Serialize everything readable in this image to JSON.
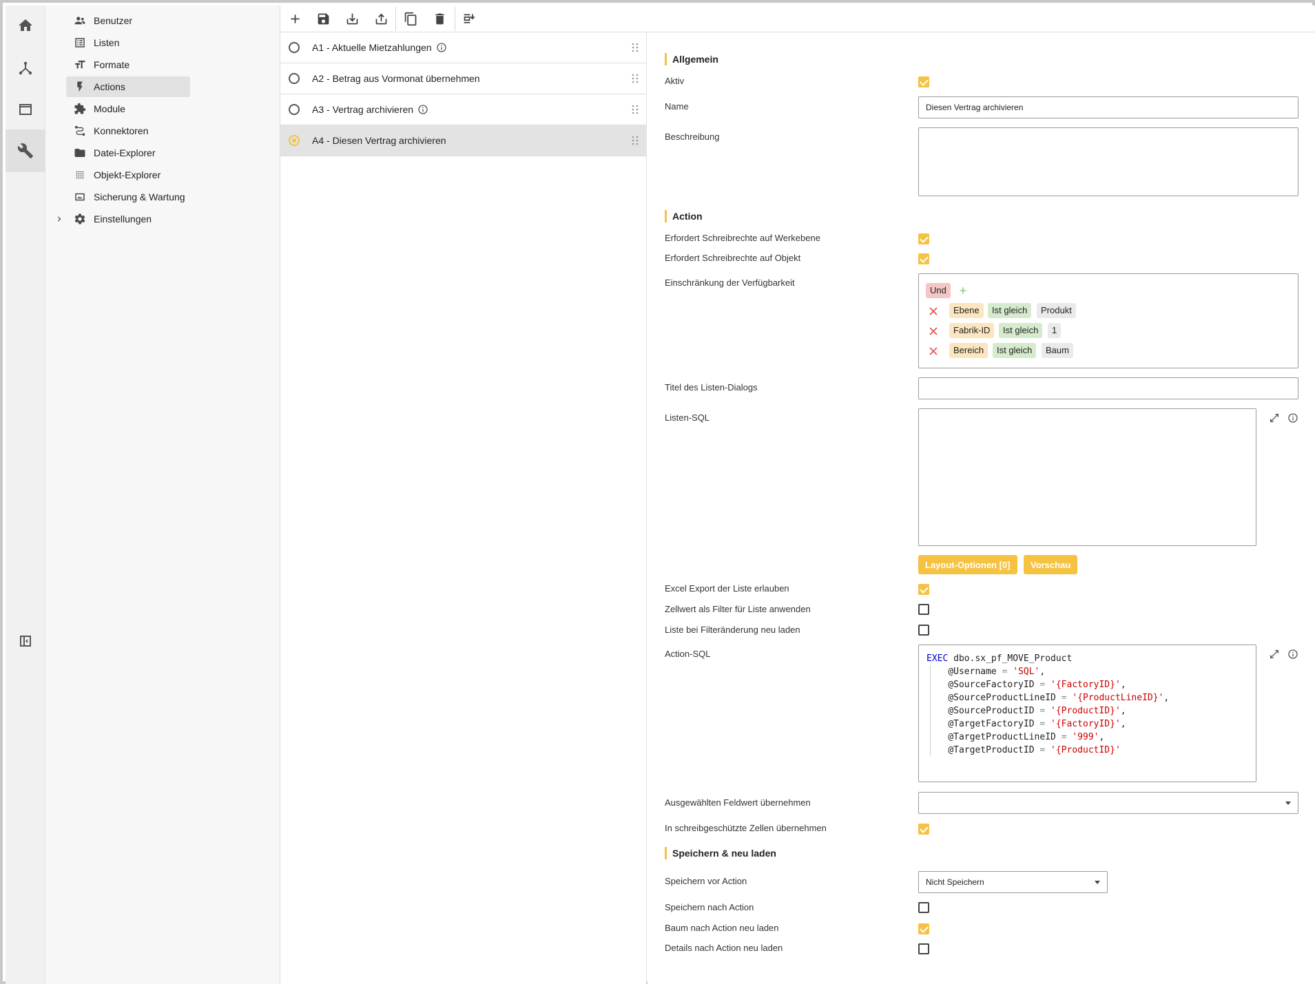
{
  "rail": {
    "items": [
      {
        "icon": "home-icon"
      },
      {
        "icon": "hierarchy-icon"
      },
      {
        "icon": "layout-icon"
      },
      {
        "icon": "wrench-icon",
        "active": true
      }
    ],
    "bottom_icon": "panel-toggle-icon"
  },
  "nav": {
    "items": [
      {
        "label": "Benutzer",
        "icon": "users-icon"
      },
      {
        "label": "Listen",
        "icon": "list-icon"
      },
      {
        "label": "Formate",
        "icon": "text-format-icon"
      },
      {
        "label": "Actions",
        "icon": "lightning-icon",
        "active": true
      },
      {
        "label": "Module",
        "icon": "puzzle-icon"
      },
      {
        "label": "Konnektoren",
        "icon": "connector-icon"
      },
      {
        "label": "Datei-Explorer",
        "icon": "folder-icon"
      },
      {
        "label": "Objekt-Explorer",
        "icon": "grid-dots-icon"
      },
      {
        "label": "Sicherung & Wartung",
        "icon": "backup-icon"
      },
      {
        "label": "Einstellungen",
        "icon": "gear-icon",
        "expandable": true
      }
    ]
  },
  "toolbar": {
    "buttons": [
      "add-icon",
      "save-icon",
      "download-icon",
      "upload-icon",
      "copy-icon",
      "delete-icon",
      "reorder-icon"
    ]
  },
  "actions": {
    "items": [
      {
        "label": "A1 - Aktuelle Mietzahlungen",
        "info": true,
        "selected": false
      },
      {
        "label": "A2 - Betrag aus Vormonat übernehmen",
        "info": false,
        "selected": false
      },
      {
        "label": "A3 - Vertrag archivieren",
        "info": true,
        "selected": false
      },
      {
        "label": "A4 - Diesen Vertrag archivieren",
        "info": false,
        "selected": true
      }
    ]
  },
  "details": {
    "sections": {
      "general": "Allgemein",
      "action": "Action",
      "save": "Speichern & neu laden"
    },
    "labels": {
      "aktiv": "Aktiv",
      "name": "Name",
      "beschreibung": "Beschreibung",
      "req_write_level": "Erfordert Schreibrechte auf Werkebene",
      "req_write_object": "Erfordert Schreibrechte auf Objekt",
      "restriction": "Einschränkung der Verfügbarkeit",
      "list_dialog_title": "Titel des Listen-Dialogs",
      "list_sql": "Listen-SQL",
      "excel_export": "Excel Export der Liste erlauben",
      "cell_as_filter": "Zellwert als Filter für Liste anwenden",
      "reload_on_filter": "Liste bei Filteränderung neu laden",
      "action_sql": "Action-SQL",
      "take_field_value": "Ausgewählten Feldwert übernehmen",
      "readonly_cells": "In schreibgeschützte Zellen übernehmen",
      "save_before": "Speichern vor Action",
      "save_after": "Speichern nach Action",
      "reload_tree": "Baum nach Action neu laden",
      "reload_details": "Details nach Action neu laden"
    },
    "values": {
      "aktiv": true,
      "name": "Diesen Vertrag archivieren",
      "beschreibung": "",
      "req_write_level": true,
      "req_write_object": true,
      "list_dialog_title": "",
      "list_sql": "",
      "excel_export": true,
      "cell_as_filter": false,
      "reload_on_filter": false,
      "take_field_value": "",
      "readonly_cells": true,
      "save_before": "Nicht Speichern",
      "save_after": false,
      "reload_tree": true,
      "reload_details": false
    },
    "filter": {
      "operator": "Und",
      "rows": [
        {
          "field": "Ebene",
          "op": "Ist gleich",
          "value": "Produkt"
        },
        {
          "field": "Fabrik-ID",
          "op": "Ist gleich",
          "value": "1"
        },
        {
          "field": "Bereich",
          "op": "Ist gleich",
          "value": "Baum"
        }
      ]
    },
    "buttons": {
      "layout_options": "Layout-Optionen [0]",
      "preview": "Vorschau"
    },
    "action_sql": {
      "line1_kw": "EXEC",
      "line1_rest": " dbo.sx_pf_MOVE_Product",
      "params": [
        {
          "name": "@Username",
          "value": "'SQL'",
          "sep": ","
        },
        {
          "name": "@SourceFactoryID",
          "value": "'{FactoryID}'",
          "sep": ","
        },
        {
          "name": "@SourceProductLineID",
          "value": "'{ProductLineID}'",
          "sep": ","
        },
        {
          "name": "@SourceProductID",
          "value": "'{ProductID}'",
          "sep": ","
        },
        {
          "name": "@TargetFactoryID",
          "value": "'{FactoryID}'",
          "sep": ","
        },
        {
          "name": "@TargetProductLineID",
          "value": "'999'",
          "sep": ","
        },
        {
          "name": "@TargetProductID",
          "value": "'{ProductID}'",
          "sep": ""
        }
      ]
    },
    "colors": {
      "accent": "#f5c242",
      "und_tag": "#f5c6c6",
      "field_tag": "#fbe6c0",
      "op_tag": "#d6ebcd",
      "value_tag": "#eaeaea",
      "remove": "#e05050"
    }
  }
}
